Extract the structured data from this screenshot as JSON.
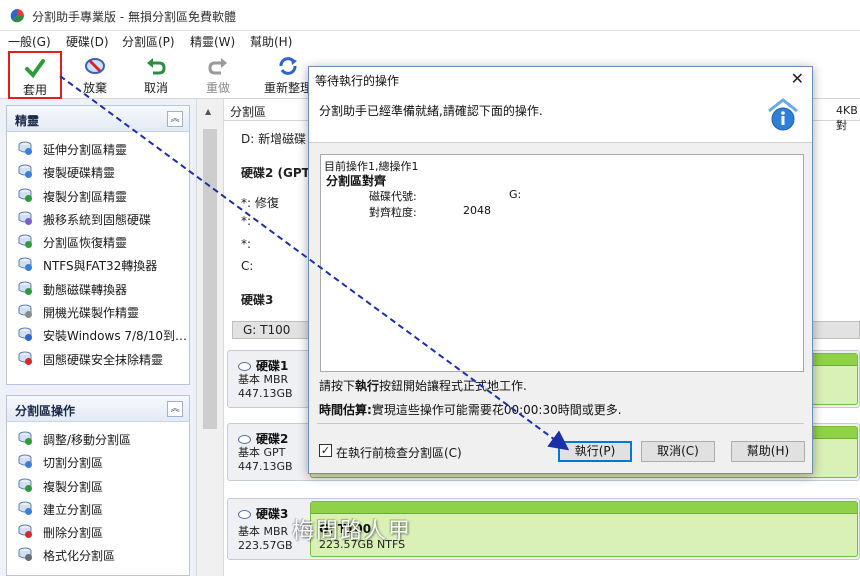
{
  "window": {
    "title": "分割助手專業版 - 無損分割區免費軟體"
  },
  "menu": [
    {
      "label": "一般(G)"
    },
    {
      "label": "硬碟(D)"
    },
    {
      "label": "分割區(P)"
    },
    {
      "label": "精靈(W)"
    },
    {
      "label": "幫助(H)"
    }
  ],
  "toolbar": {
    "apply": "套用",
    "discard": "放棄",
    "undo": "取消",
    "redo": "重做",
    "reload": "重新整理"
  },
  "wizards": {
    "title": "精靈",
    "items": [
      {
        "label": "延伸分割區精靈",
        "icon": "extend-icon"
      },
      {
        "label": "複製硬碟精靈",
        "icon": "copy-disk-icon"
      },
      {
        "label": "複製分割區精靈",
        "icon": "copy-partition-icon"
      },
      {
        "label": "搬移系統到固態硬碟",
        "icon": "migrate-os-icon"
      },
      {
        "label": "分割區恢復精靈",
        "icon": "recovery-icon"
      },
      {
        "label": "NTFS與FAT32轉換器",
        "icon": "convert-icon"
      },
      {
        "label": "動態磁碟轉換器",
        "icon": "dynamic-disk-icon"
      },
      {
        "label": "開機光碟製作精靈",
        "icon": "bootable-disc-icon"
      },
      {
        "label": "安裝Windows 7/8/10到…",
        "icon": "windows-icon"
      },
      {
        "label": "固態硬碟安全抹除精靈",
        "icon": "ssd-erase-icon"
      }
    ]
  },
  "partition_ops": {
    "title": "分割區操作",
    "items": [
      {
        "label": "調整/移動分割區",
        "icon": "resize-icon"
      },
      {
        "label": "切割分割區",
        "icon": "split-icon"
      },
      {
        "label": "複製分割區",
        "icon": "copy-icon"
      },
      {
        "label": "建立分割區",
        "icon": "create-icon"
      },
      {
        "label": "刪除分割區",
        "icon": "delete-icon"
      },
      {
        "label": "格式化分割區",
        "icon": "format-icon"
      }
    ]
  },
  "main": {
    "col_partition": "分割區",
    "col_right": "4KB對",
    "rows": [
      {
        "text": "D: 新增磁碟"
      },
      {
        "text": "硬碟2 (GPT)"
      },
      {
        "text": "*: 修復"
      },
      {
        "text": "*:"
      },
      {
        "text": "*:"
      },
      {
        "text": "C:"
      },
      {
        "text": "硬碟3"
      }
    ],
    "selected_row": "G: T100"
  },
  "disks": [
    {
      "name": "硬碟1",
      "type": "基本 MBR",
      "size": "447.13GB"
    },
    {
      "name": "硬碟2",
      "type": "基本 GPT",
      "size": "447.13GB"
    },
    {
      "name": "硬碟3",
      "type": "基本 MBR",
      "size": "223.57GB",
      "part_name": "G: T100",
      "part_size": "223.57GB NTFS"
    }
  ],
  "dialog": {
    "title": "等待執行的操作",
    "header": "分割助手已經準備就緒,請確認下面的操作.",
    "summary": "目前操作1,總操作1",
    "op_title": "分割區對齊",
    "drive_label": "磁碟代號:",
    "drive_value": "G:",
    "align_label": "對齊粒度:",
    "align_value": "2048",
    "hint_pre": "請按下",
    "hint_bold": "執行",
    "hint_post": "按鈕開始讓程式正式地工作.",
    "time_label": "時間估算:",
    "time_value": "實現這些操作可能需要花00:00:30時間或更多.",
    "check_label": "在執行前檢查分割區(C)",
    "btn_execute": "執行(P)",
    "btn_cancel": "取消(C)",
    "btn_help": "幫助(H)"
  },
  "watermark": "梅問路人甲",
  "colors": {
    "accent": "#e0201f",
    "green_band": "#8fd24a",
    "arrow": "#1c2fa8"
  }
}
